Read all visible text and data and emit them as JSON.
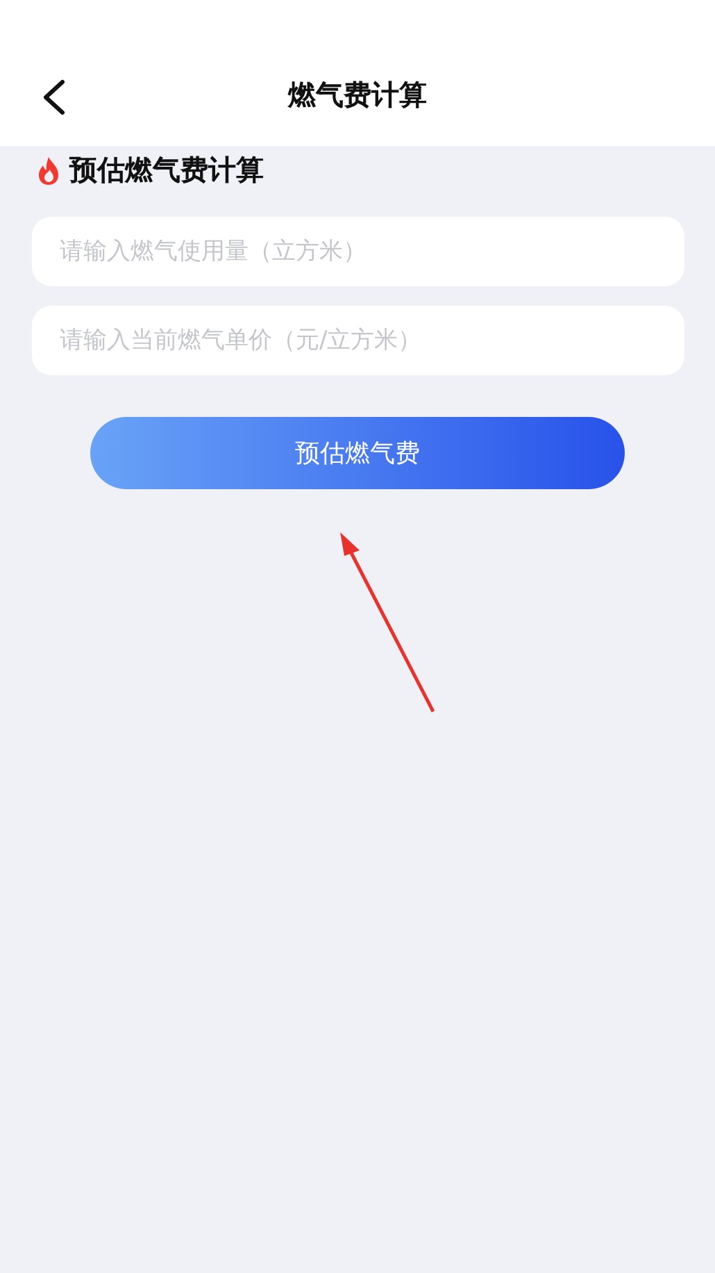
{
  "header": {
    "title": "燃气费计算"
  },
  "section": {
    "title": "预估燃气费计算"
  },
  "fields": [
    {
      "placeholder": "请输入燃气使用量（立方米）"
    },
    {
      "placeholder": "请输入当前燃气单价（元/立方米）"
    }
  ],
  "button": {
    "label": "预估燃气费"
  }
}
